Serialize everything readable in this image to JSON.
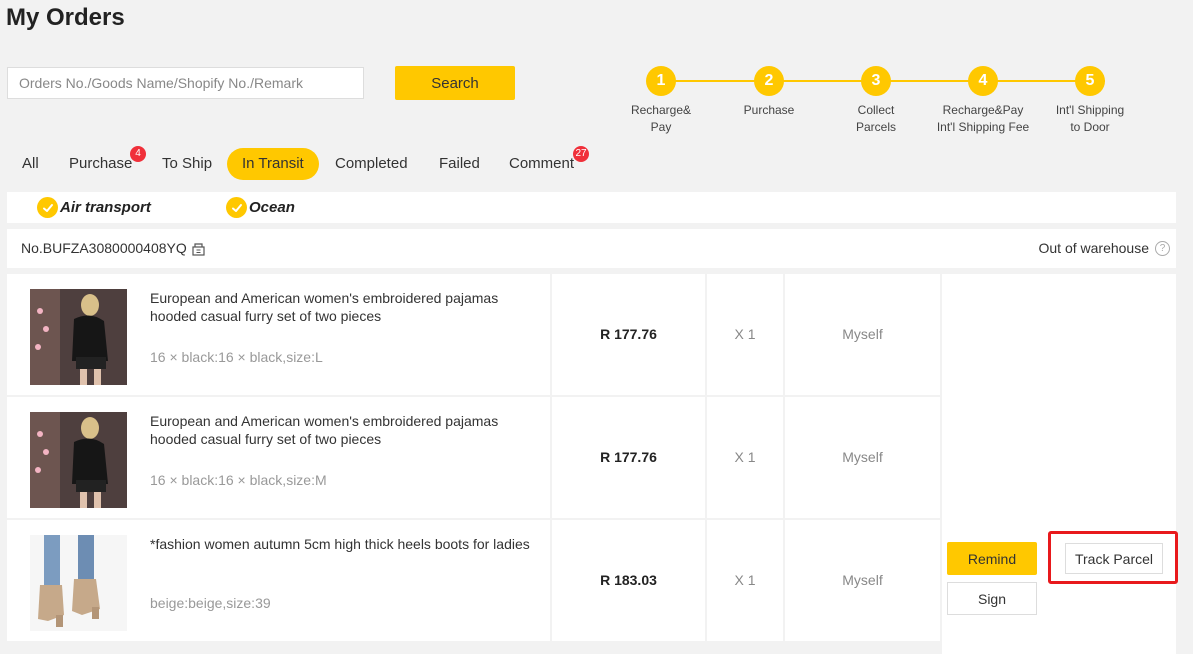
{
  "page": {
    "title": "My Orders"
  },
  "search": {
    "placeholder": "Orders No./Goods Name/Shopify No./Remark",
    "value": "",
    "button_label": "Search"
  },
  "steps": [
    {
      "num": "1",
      "label": "Recharge&\nPay"
    },
    {
      "num": "2",
      "label": "Purchase"
    },
    {
      "num": "3",
      "label": "Collect\nParcels"
    },
    {
      "num": "4",
      "label": "Recharge&Pay\nInt'l Shipping Fee"
    },
    {
      "num": "5",
      "label": "Int'l Shipping\nto Door"
    }
  ],
  "tabs": [
    {
      "label": "All"
    },
    {
      "label": "Purchase",
      "badge": "4"
    },
    {
      "label": "To Ship"
    },
    {
      "label": "In Transit",
      "active": true
    },
    {
      "label": "Completed"
    },
    {
      "label": "Failed"
    },
    {
      "label": "Comment",
      "badge": "27"
    }
  ],
  "filters": [
    {
      "label": "Air transport",
      "checked": true
    },
    {
      "label": "Ocean",
      "checked": true
    }
  ],
  "order": {
    "number": "No.BUFZA3080000408YQ",
    "status": "Out of warehouse",
    "items": [
      {
        "title": "European and American women's embroidered pajamas hooded casual furry set of two pieces",
        "spec": "16 × black:16 × black,size:L",
        "price": "R 177.76",
        "qty": "X 1",
        "receiver": "Myself"
      },
      {
        "title": "European and American women's embroidered pajamas hooded casual furry set of two pieces",
        "spec": "16 × black:16 × black,size:M",
        "price": "R 177.76",
        "qty": "X 1",
        "receiver": "Myself"
      },
      {
        "title": "*fashion women autumn 5cm high thick heels boots for ladies",
        "spec": "beige:beige,size:39",
        "price": "R 183.03",
        "qty": "X 1",
        "receiver": "Myself"
      }
    ],
    "actions": {
      "remind": "Remind",
      "sign": "Sign",
      "track": "Track Parcel"
    }
  },
  "colors": {
    "accent": "#ffc800",
    "badge": "#f0303a",
    "highlight": "#e8191c",
    "background": "#f2f2f2"
  }
}
